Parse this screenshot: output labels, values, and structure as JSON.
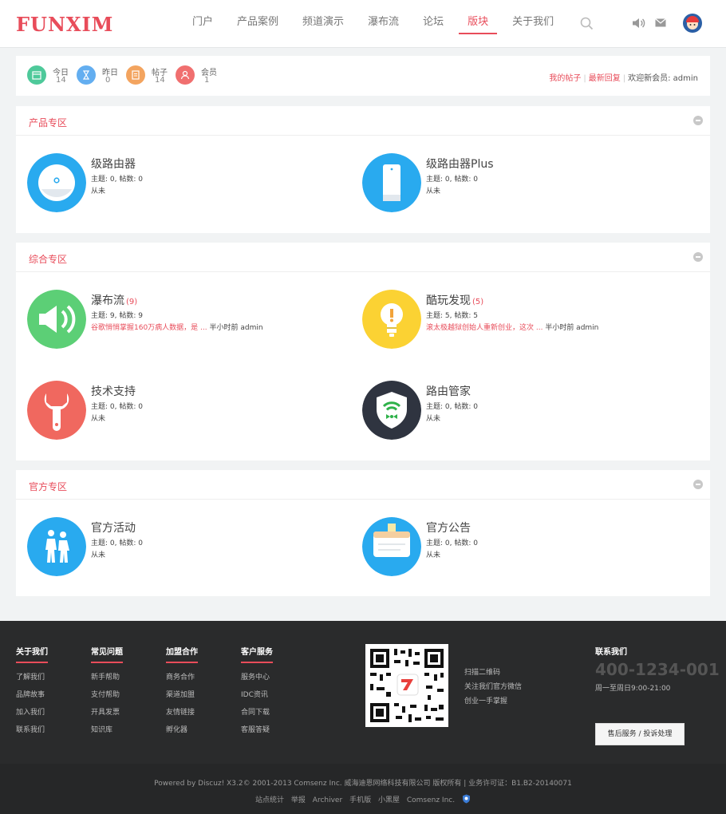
{
  "header": {
    "logo": "FUNXIM",
    "nav": [
      {
        "label": "门户"
      },
      {
        "label": "产品案例"
      },
      {
        "label": "频道演示"
      },
      {
        "label": "瀑布流"
      },
      {
        "label": "论坛"
      },
      {
        "label": "版块"
      },
      {
        "label": "关于我们"
      }
    ],
    "active_nav": "版块",
    "accent": "#e84c5a"
  },
  "stats": {
    "items": [
      {
        "label": "今日",
        "value": "14",
        "color": "#4ec99a",
        "icon": "calendar-icon"
      },
      {
        "label": "昨日",
        "value": "0",
        "color": "#63aef0",
        "icon": "hourglass-icon"
      },
      {
        "label": "帖子",
        "value": "14",
        "color": "#f3a45f",
        "icon": "document-icon"
      },
      {
        "label": "会员",
        "value": "1",
        "color": "#f06f6f",
        "icon": "user-icon"
      }
    ],
    "links": {
      "my_posts": "我的帖子",
      "latest_replies": "最新回复",
      "welcome": "欢迎新会员: admin"
    }
  },
  "sections": [
    {
      "title": "产品专区",
      "forums": [
        {
          "name": "级路由器",
          "count": "",
          "meta": "主题: 0, 帖数: 0",
          "last_hl": "",
          "last": "从未",
          "icon": "router-icon",
          "color": "#29aaef"
        },
        {
          "name": "级路由器Plus",
          "count": "",
          "meta": "主题: 0, 帖数: 0",
          "last_hl": "",
          "last": "从未",
          "icon": "router-plus-icon",
          "color": "#29aaef"
        }
      ]
    },
    {
      "title": "综合专区",
      "forums": [
        {
          "name": "瀑布流",
          "count": "(9)",
          "meta": "主题: 9, 帖数: 9",
          "last_hl": "谷歌悄悄掌握160万病人数据，是 ...",
          "last": " 半小时前 admin",
          "icon": "speaker-icon",
          "color": "#5ccf76"
        },
        {
          "name": "酷玩发现",
          "count": "(5)",
          "meta": "主题: 5, 帖数: 5",
          "last_hl": "滚太极越狱创始人重新创业，这次 ...",
          "last": " 半小时前 admin",
          "icon": "lightbulb-icon",
          "color": "#fbd233"
        },
        {
          "name": "技术支持",
          "count": "",
          "meta": "主题: 0, 帖数: 0",
          "last_hl": "",
          "last": "从未",
          "icon": "wrench-icon",
          "color": "#f0685f"
        },
        {
          "name": "路由管家",
          "count": "",
          "meta": "主题: 0, 帖数: 0",
          "last_hl": "",
          "last": "从未",
          "icon": "wifi-shield-icon",
          "color": "#2f3440"
        }
      ]
    },
    {
      "title": "官方专区",
      "forums": [
        {
          "name": "官方活动",
          "count": "",
          "meta": "主题: 0, 帖数: 0",
          "last_hl": "",
          "last": "从未",
          "icon": "people-icon",
          "color": "#29aaef"
        },
        {
          "name": "官方公告",
          "count": "",
          "meta": "主题: 0, 帖数: 0",
          "last_hl": "",
          "last": "从未",
          "icon": "notice-icon",
          "color": "#29aaef"
        }
      ]
    }
  ],
  "footer": {
    "columns": [
      {
        "title": "关于我们",
        "items": [
          "了解我们",
          "品牌故事",
          "加入我们",
          "联系我们"
        ]
      },
      {
        "title": "常见问题",
        "items": [
          "新手帮助",
          "支付帮助",
          "开具发票",
          "知识库"
        ]
      },
      {
        "title": "加盟合作",
        "items": [
          "商务合作",
          "渠道加盟",
          "友情链接",
          "孵化器"
        ]
      },
      {
        "title": "客户服务",
        "items": [
          "服务中心",
          "IDC资讯",
          "合同下载",
          "客服答疑"
        ]
      }
    ],
    "qr_text": [
      "扫描二维码",
      "关注我们官方微信",
      "创业一手掌握"
    ],
    "contact": {
      "title": "联系我们",
      "phone": "400-1234-001",
      "hours": "周一至周日9:00-21:00",
      "button": "售后服务 / 投诉处理"
    }
  },
  "copyright": {
    "line": "Powered by Discuz! X3.2© 2001-2013 Comsenz Inc.  威海迪恩网络科技有限公司 版权所有    | 业务许可证：B1.B2-20140071",
    "links": [
      "站点统计",
      "举报",
      "Archiver",
      "手机版",
      "小黑屋",
      "Comsenz Inc."
    ]
  }
}
